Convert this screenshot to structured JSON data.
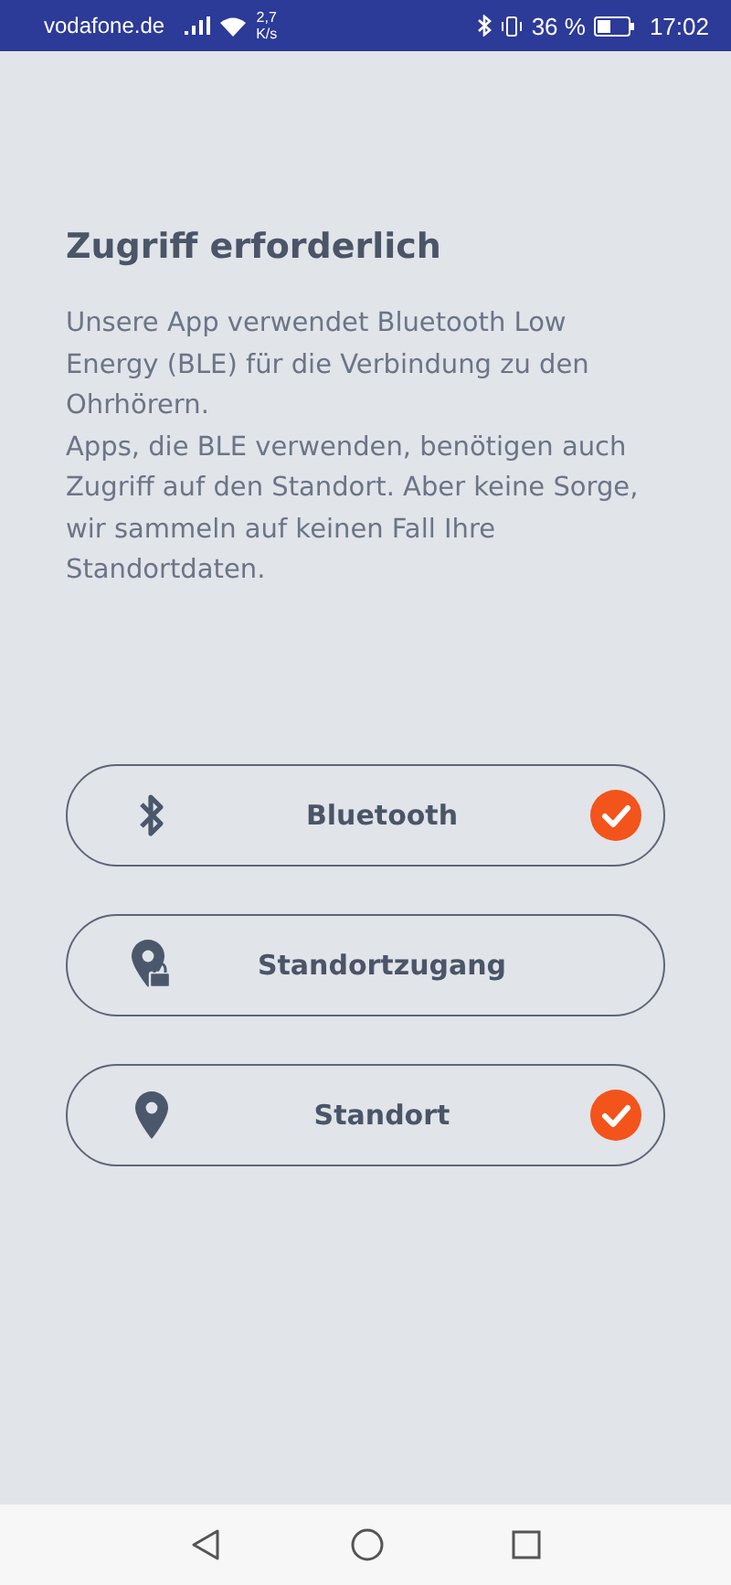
{
  "status_bar": {
    "carrier": "vodafone.de",
    "speed": "2,7",
    "speed_unit": "K/s",
    "battery": "36 %",
    "time": "17:02"
  },
  "title": "Zugriff erforderlich",
  "paragraphs": [
    "Unsere App verwendet Bluetooth Low Energy (BLE) für die Verbindung zu den Ohrhörern.",
    "Apps, die BLE verwenden, benötigen auch Zugriff auf den Standort. Aber keine Sorge, wir sammeln auf keinen Fall Ihre Standortdaten."
  ],
  "permissions": [
    {
      "kind": "bluetooth",
      "label": "Bluetooth",
      "granted": true
    },
    {
      "kind": "location-lock",
      "label": "Standortzugang",
      "granted": false
    },
    {
      "kind": "location",
      "label": "Standort",
      "granted": true
    }
  ]
}
